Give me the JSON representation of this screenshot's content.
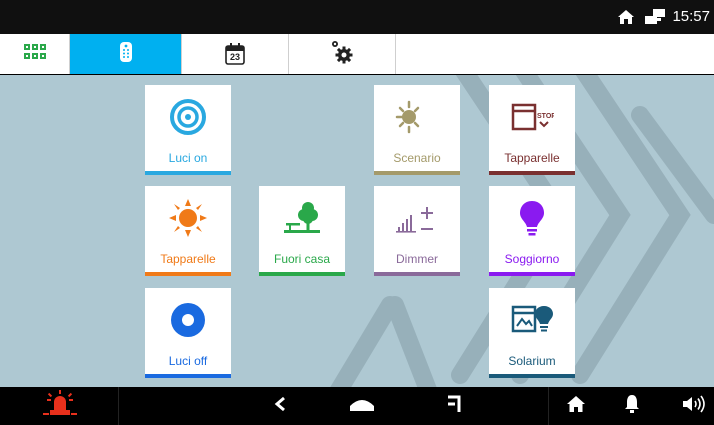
{
  "status_bar": {
    "time": "15:57",
    "icons": [
      "home-status-icon",
      "network-status-icon"
    ]
  },
  "tabs": [
    {
      "name": "tab-apps",
      "icon": "grid-icon",
      "active": false
    },
    {
      "name": "tab-remote",
      "icon": "remote-icon",
      "active": true
    },
    {
      "name": "tab-calendar",
      "icon": "calendar-icon",
      "label": "23",
      "active": false
    },
    {
      "name": "tab-settings",
      "icon": "gear-icon",
      "active": false
    }
  ],
  "tiles": [
    {
      "label": "Luci on",
      "icon": "target-icon",
      "color": "#29a8e0"
    },
    {
      "label": "Scenario",
      "icon": "sun-moon-icon",
      "color": "#a49a6a"
    },
    {
      "label": "Tapparelle",
      "icon": "shutter-stop-icon",
      "color": "#7a3030"
    },
    {
      "label": "Tapparelle",
      "icon": "sun-icon",
      "color": "#f07a18"
    },
    {
      "label": "Fuori casa",
      "icon": "tree-bench-icon",
      "color": "#2aa84a"
    },
    {
      "label": "Dimmer",
      "icon": "dimmer-icon",
      "color": "#8a6a9a"
    },
    {
      "label": "Soggiorno",
      "icon": "bulb-icon",
      "color": "#8a1af0"
    },
    {
      "label": "Luci off",
      "icon": "circle-off-icon",
      "color": "#1a6ae0"
    },
    {
      "label": "Solarium",
      "icon": "solarium-icon",
      "color": "#1a5a7a"
    }
  ],
  "nav_bar": {
    "buttons": [
      "alarm-icon",
      "back-icon",
      "home-icon",
      "recent-icon",
      "house-icon",
      "bell-icon",
      "volume-icon"
    ]
  },
  "colors": {
    "tab_active": "#00b0f0",
    "background": "#aec8d2",
    "alarm": "#e8301c"
  }
}
